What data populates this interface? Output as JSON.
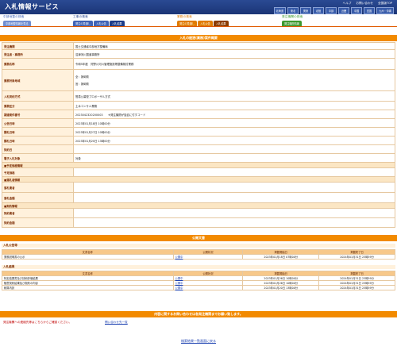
{
  "header": {
    "title": "入札情報サービス",
    "links": [
      "ヘルプ",
      "お問い合わせ",
      "全国版TOP"
    ],
    "regions": [
      "北海道",
      "東北",
      "関東",
      "北陸",
      "中部",
      "近畿",
      "中国",
      "四国",
      "九州・沖縄"
    ]
  },
  "groups": [
    {
      "title": "中部地整の検索",
      "tabs": [
        "中部地整情報を見る"
      ]
    },
    {
      "title": "工事の検索",
      "tabs": [
        "発注の見通し",
        "入札公告",
        "入札結果"
      ]
    },
    {
      "title": "業務の検索",
      "tabs": [
        "発注の見通し",
        "入札公告",
        "入札結果"
      ]
    },
    {
      "title": "発注機関の検索",
      "tabs": [
        "発注機関情報"
      ]
    }
  ],
  "main_title": "入札の経過(業務)案件概要",
  "detail": [
    {
      "label": "発注機関",
      "value": "国土交通省中部地方整備局"
    },
    {
      "label": "発注者・事務所",
      "value": "沼津河川国道事務所"
    },
    {
      "label": "業務名称",
      "value": "令和5年度　狩野川河川管理施設等整備検討業務"
    },
    {
      "label": "業務対象地域",
      "value": "全：静岡県\n\n宮：静岡県"
    },
    {
      "label": "入札契約方式",
      "value": "簡易公募型プロポーザル方式"
    },
    {
      "label": "業務区分",
      "value": "土木コンサル業務"
    },
    {
      "label": "調達案件番号",
      "value": "2023042320200003　　※発注機関が独自に付すコード"
    },
    {
      "label": "公告日時",
      "value": "2023年01月18日 10時00分"
    },
    {
      "label": "開札日時",
      "value": "2023年01月27日 10時00分"
    },
    {
      "label": "開札日時",
      "value": "2023年01月20日 13時00分"
    },
    {
      "label": "契約日",
      "value": ""
    },
    {
      "label": "電子入札対象",
      "value": "対象"
    }
  ],
  "sections": [
    {
      "title": "■予定価格情報",
      "rows": [
        "予定価格"
      ]
    },
    {
      "title": "■落札者情報",
      "rows": [
        "落札業者",
        "落札金額"
      ]
    },
    {
      "title": "■契約情報",
      "rows": [
        "契約業者",
        "契約金額"
      ]
    }
  ],
  "docs": {
    "title": "公開文書",
    "koukoku": {
      "heading": "入札公告等",
      "columns": [
        "文書名称",
        "公開状況",
        "掲載開始日",
        "掲載終了日"
      ],
      "rows": [
        [
          "業務説明書の公示",
          "公開中",
          "2023年01月18日 07時00分",
          "2024年01月31日 23時59分"
        ]
      ]
    },
    "kekka": {
      "heading": "入札結果",
      "columns": [
        "文書名称",
        "公開状況",
        "掲載開始日",
        "掲載終了日"
      ],
      "rows": [
        [
          "特定結果書及び技術評価結果",
          "公開中",
          "2023年01月26日 10時00分",
          "2024年01月31日 23時59分"
        ],
        [
          "随意契約結果及び契約の内容",
          "公開中",
          "2023年01月26日 10時00分",
          "2024年01月31日 23時59分"
        ],
        [
          "積算内訳",
          "公開中",
          "2023年01月20日 13時00分",
          "2024年01月31日 23時59分"
        ]
      ]
    }
  },
  "contact": {
    "bar": "内容に関するお問い合わせは各発注機関までお願い致します。",
    "message": "発注機関への連絡先等はこちらからご確認ください。",
    "link": "問い合わせ先一覧"
  },
  "back_link": "検索結果一覧画面に戻る",
  "colors": {
    "header": "#1b3576",
    "accent": "#f28a00",
    "label_bg": "#fff1dc"
  }
}
